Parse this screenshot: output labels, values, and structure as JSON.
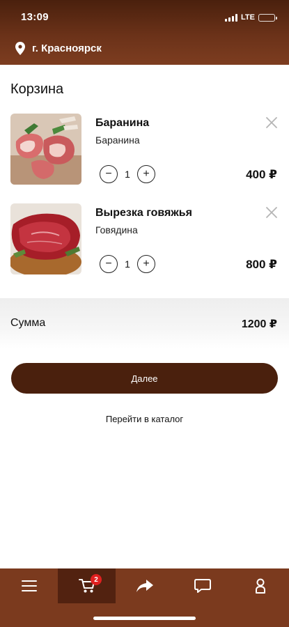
{
  "status_bar": {
    "time": "13:09",
    "network": "LTE"
  },
  "location": {
    "city": "г. Красноярск",
    "icon": "map-pin-icon"
  },
  "cart": {
    "title": "Корзина",
    "items": [
      {
        "name": "Баранина",
        "category": "Баранина",
        "quantity": "1",
        "price": "400 ₽",
        "minus": "−",
        "plus": "+"
      },
      {
        "name": "Вырезка говяжья",
        "category": "Говядина",
        "quantity": "1",
        "price": "800 ₽",
        "minus": "−",
        "plus": "+"
      }
    ]
  },
  "summary": {
    "label": "Сумма",
    "total": "1200 ₽"
  },
  "actions": {
    "next_label": "Далее",
    "catalog_link": "Перейти в каталог"
  },
  "tabbar": {
    "items": [
      {
        "icon": "menu-icon"
      },
      {
        "icon": "cart-icon",
        "badge": "2",
        "active": true
      },
      {
        "icon": "share-arrow-icon"
      },
      {
        "icon": "chat-icon"
      },
      {
        "icon": "profile-icon"
      }
    ]
  },
  "colors": {
    "brand_dark": "#4a200d",
    "brand": "#7b3a1e",
    "badge": "#e02020"
  }
}
